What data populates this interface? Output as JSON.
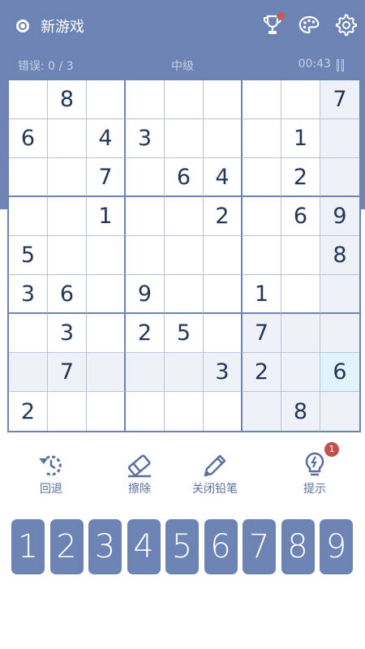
{
  "header": {
    "new_game_label": "新游戏",
    "icons": [
      "radio-icon",
      "trophy-icon",
      "palette-icon",
      "gear-icon"
    ]
  },
  "status": {
    "errors": "错误: 0 / 3",
    "level": "中级",
    "timer": "00:43"
  },
  "board": {
    "rows": [
      [
        "",
        "8",
        "",
        "",
        "",
        "",
        "",
        "",
        "7"
      ],
      [
        "6",
        "",
        "4",
        "3",
        "",
        "",
        "",
        "1",
        ""
      ],
      [
        "",
        "",
        "7",
        "",
        "6",
        "4",
        "",
        "2",
        ""
      ],
      [
        "",
        "",
        "1",
        "",
        "",
        "2",
        "",
        "6",
        "9"
      ],
      [
        "5",
        "",
        "",
        "",
        "",
        "",
        "",
        "",
        "8"
      ],
      [
        "3",
        "6",
        "",
        "9",
        "",
        "",
        "1",
        "",
        ""
      ],
      [
        "",
        "3",
        "",
        "2",
        "5",
        "",
        "7",
        "",
        ""
      ],
      [
        "",
        "7",
        "",
        "",
        "",
        "3",
        "2",
        "",
        "6"
      ],
      [
        "2",
        "",
        "",
        "",
        "",
        "",
        "",
        "8",
        ""
      ]
    ],
    "selected_cell": {
      "row": 7,
      "col": 8
    },
    "colors": {
      "highlight": "#eef1f7",
      "selected": "#e3f3fb",
      "digit": "#263657"
    }
  },
  "tools": {
    "undo_label": "回退",
    "erase_label": "擦除",
    "pencil_label": "关闭铅笔",
    "hint_label": "提示",
    "hint_badge": "1"
  },
  "numpad": {
    "keys": [
      "1",
      "2",
      "3",
      "4",
      "5",
      "6",
      "7",
      "8",
      "9"
    ]
  },
  "theme": {
    "accent": "#6d83b3",
    "badge_red": "#c2504b"
  }
}
